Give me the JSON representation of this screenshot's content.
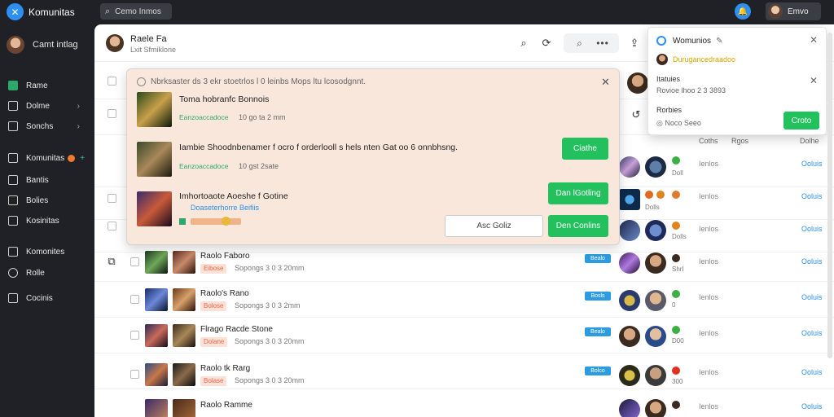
{
  "app": {
    "title": "Komunitas",
    "logo_icon": "app-logo-icon"
  },
  "search": {
    "placeholder": "Cemo Inmos"
  },
  "user_chip": {
    "label": "Emvo"
  },
  "sidebar": {
    "user": "Camt intlag",
    "items": [
      {
        "label": "Rame",
        "active": true
      },
      {
        "label": "Dolme",
        "chevron": true
      },
      {
        "label": "Sonchs",
        "chevron": true
      },
      {
        "label": "Komunitas",
        "badge": true,
        "plus": "+"
      },
      {
        "label": "Bantis"
      },
      {
        "label": "Bolies"
      },
      {
        "label": "Kosinitas"
      },
      {
        "label": "Komonites"
      },
      {
        "label": "Rolle"
      },
      {
        "label": "Cocinis"
      }
    ]
  },
  "header": {
    "title": "Raele Fa",
    "subtitle": "Lxit Sfmiklone",
    "more": "•••"
  },
  "columns": {
    "c1": "Coths",
    "c2": "Rgos",
    "c3": "Dolhe"
  },
  "rows": [
    {
      "title": "Raolo Faboro",
      "tag": "Eibose",
      "meta": "Sopongs 3 0 3 20mm",
      "chip": "Bealo",
      "num": "ShrI",
      "col": "Ienlos",
      "link": "Ooluis"
    },
    {
      "title": "Raolo's Rano",
      "tag": "Bolose",
      "meta": "Sopongs 3 0 3 2mm",
      "chip": "Bosls",
      "num": "0",
      "col": "Ienlos",
      "link": "Ooluis"
    },
    {
      "title": "Flrago Racde Stone",
      "tag": "Dolane",
      "meta": "Sopongs 3 0 3 20mm",
      "chip": "Bealo",
      "num": "D00",
      "col": "Ienlos",
      "link": "Ooluis"
    },
    {
      "title": "Raolo tk Rarg",
      "tag": "Bolase",
      "meta": "Sopongs 3 0 3 20mm",
      "chip": "Bolco",
      "num": "300",
      "col": "Ienlos",
      "link": "Ooluis"
    },
    {
      "title": "Raolo Ramme",
      "tag": "",
      "meta": "",
      "chip": "",
      "num": "",
      "col": "Ienlos",
      "link": "Ooluis"
    }
  ],
  "upper_rows": [
    {
      "num": "Doll",
      "col": "Ienlos",
      "link": "Ooluis"
    },
    {
      "num": "Dolls",
      "col": "Ienlos",
      "link": "Ooluis"
    },
    {
      "num": "Dolls",
      "col": "Ienlos",
      "link": "Ooluis"
    }
  ],
  "modal": {
    "header": "Nbrksaster ds 3 ekr stoetrlos l 0 leinbs Mops ltu lcosodgnnt.",
    "items": [
      {
        "title": "Toma hobranfc Bonnois",
        "green": "Eanzoaccadoce",
        "meta": "10 go ta 2 mm"
      },
      {
        "title": "Iambie Shoodnbenamer f ocro f orderlooll s hels nten Gat oo 6 onnbhsng.",
        "green": "Eanzoaccadoce",
        "meta": "10 gst 2sate",
        "button": "Ciathe"
      },
      {
        "title": "Imhortoaote Aoeshe f Gotine",
        "blue": "Doaseterhorre Beifiis",
        "button": "Dan lGotling"
      }
    ],
    "secondary": "Asc Goliz",
    "primary": "Den Conlins"
  },
  "popover": {
    "title": "Womunios",
    "line1": "Durugancedraadoo",
    "section": "Itatuies",
    "section_sub": "Rovioe lhoo 2 3 3893",
    "section2": "Rorbies",
    "footer": "Noco Seeo",
    "button": "Croto"
  }
}
